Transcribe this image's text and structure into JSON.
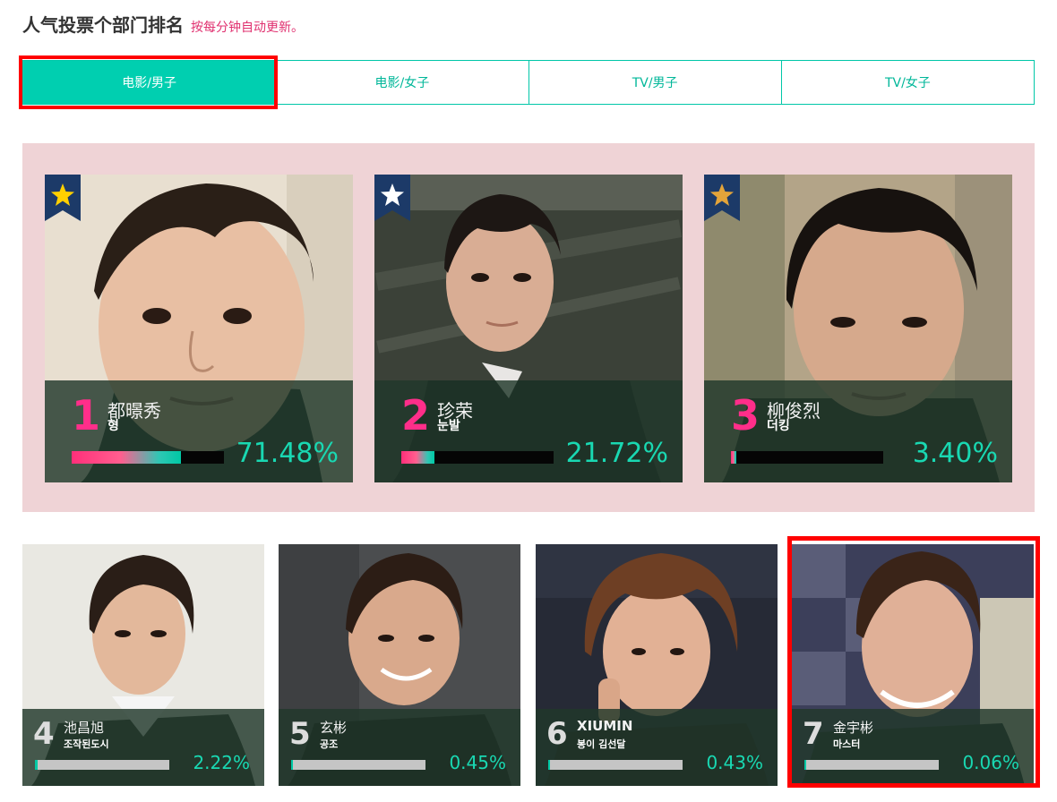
{
  "header": {
    "title": "人气投票个部门排名",
    "note": "按每分钟自动更新。"
  },
  "tabs": [
    {
      "label": "电影/男子",
      "active": true
    },
    {
      "label": "电影/女子",
      "active": false
    },
    {
      "label": "TV/男子",
      "active": false
    },
    {
      "label": "TV/女子",
      "active": false
    }
  ],
  "colors": {
    "accent": "#00cfb0",
    "rank_pink": "#ff2e8a",
    "panel_bg": "#efd3d6",
    "ribbon_navy": "#1c3a68",
    "star_gold": "#ffd000",
    "star_white": "#ffffff",
    "star_bronze": "#e3a43a",
    "highlight": "#ff0000"
  },
  "top_ranked": [
    {
      "rank": "1",
      "name": "都暻秀",
      "role": "형",
      "percent": "71.48%",
      "share": 71.48,
      "ribbon_star": "gold-star-icon"
    },
    {
      "rank": "2",
      "name": "珍荣",
      "role": "눈발",
      "percent": "21.72%",
      "share": 21.72,
      "ribbon_star": "white-star-icon"
    },
    {
      "rank": "3",
      "name": "柳俊烈",
      "role": "더킹",
      "percent": "3.40%",
      "share": 3.4,
      "ribbon_star": "bronze-star-icon"
    }
  ],
  "others": [
    {
      "rank": "4",
      "name": "池昌旭",
      "role": "조작된도시",
      "percent": "2.22%",
      "share": 2.22
    },
    {
      "rank": "5",
      "name": "玄彬",
      "role": "공조",
      "percent": "0.45%",
      "share": 0.45
    },
    {
      "rank": "6",
      "name": "XIUMIN",
      "role": "봉이 김선달",
      "percent": "0.43%",
      "share": 0.43
    },
    {
      "rank": "7",
      "name": "金宇彬",
      "role": "마스터",
      "percent": "0.06%",
      "share": 0.06
    }
  ]
}
